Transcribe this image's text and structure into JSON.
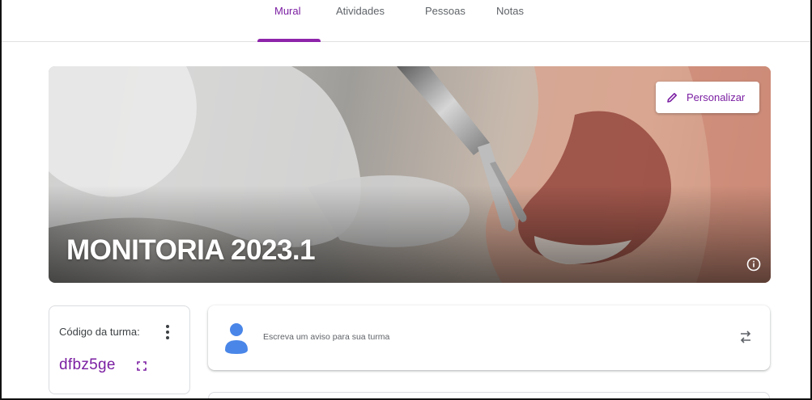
{
  "tabs": [
    {
      "label": "Mural",
      "active": true
    },
    {
      "label": "Atividades",
      "active": false
    },
    {
      "label": "Pessoas",
      "active": false
    },
    {
      "label": "Notas",
      "active": false
    }
  ],
  "banner": {
    "title": "MONITORIA 2023.1",
    "customize_label": "Personalizar",
    "info_icon": "info-icon",
    "edit_icon": "pencil-icon"
  },
  "class_code": {
    "label": "Código da turma:",
    "value": "dfbz5ge",
    "menu_icon": "more-vert-icon",
    "expand_icon": "fullscreen-icon"
  },
  "announcement": {
    "placeholder": "Escreva um aviso para sua turma",
    "repost_icon": "repost-icon"
  },
  "colors": {
    "accent": "#7b1fa2",
    "indicator": "#8e24aa",
    "avatar": "#4a86e8"
  }
}
